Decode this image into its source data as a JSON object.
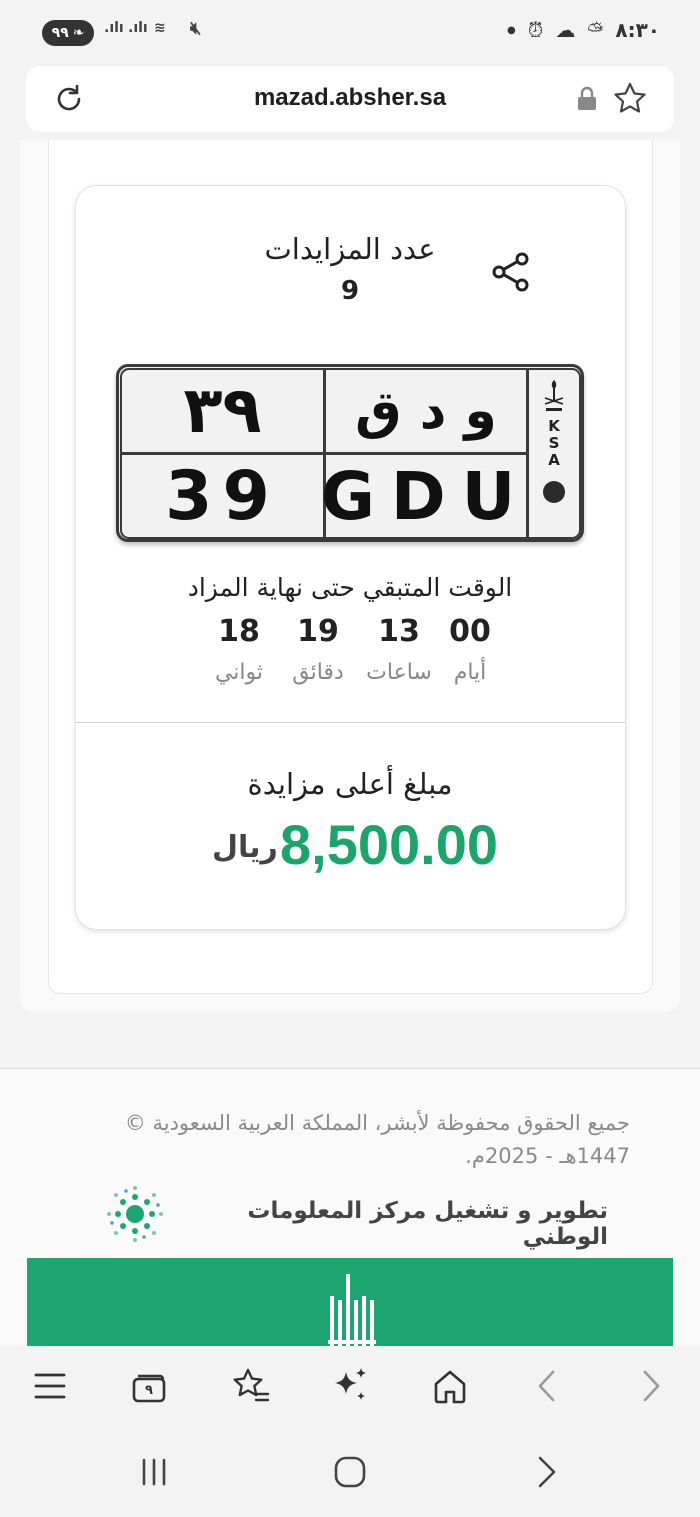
{
  "status_bar": {
    "pill_text": "٩٩",
    "time": "٨:٣٠"
  },
  "browser": {
    "url": "mazad.absher.sa"
  },
  "auction": {
    "bids_label": "عدد المزايدات",
    "bids_count": "9",
    "plate": {
      "numbers_ar": "٣٩",
      "letters_ar": "و د ق",
      "numbers_en": "39",
      "letters_en": "GDU",
      "country": [
        "K",
        "S",
        "A"
      ]
    },
    "remaining_label": "الوقت المتبقي حتى نهاية المزاد",
    "countdown": {
      "days": "00",
      "hours": "13",
      "minutes": "19",
      "seconds": "18",
      "days_label": "أيام",
      "hours_label": "ساعات",
      "minutes_label": "دقائق",
      "seconds_label": "ثواني"
    },
    "highest_bid_label": "مبلغ أعلى مزايدة",
    "highest_bid_amount": "8,500.00",
    "currency": "ريال"
  },
  "footer": {
    "copyright": "جميع الحقوق محفوظة لأبشر، المملكة العربية السعودية © 1447هـ - 2025م.",
    "developed_by": "تطوير و تشغيل مركز المعلومات الوطني"
  },
  "toolbar": {
    "tabs_count": "٩"
  },
  "colors": {
    "accent_green": "#1ba56a",
    "banner_green": "#1ea672"
  },
  "icons": [
    "reload-icon",
    "lock-icon",
    "bookmark-star-icon",
    "share-icon",
    "menu-icon",
    "tabs-icon",
    "bookmarks-icon",
    "ai-sparkle-icon",
    "home-icon",
    "back-icon",
    "forward-icon",
    "recent-apps-icon",
    "home-nav-icon",
    "back-nav-icon"
  ]
}
